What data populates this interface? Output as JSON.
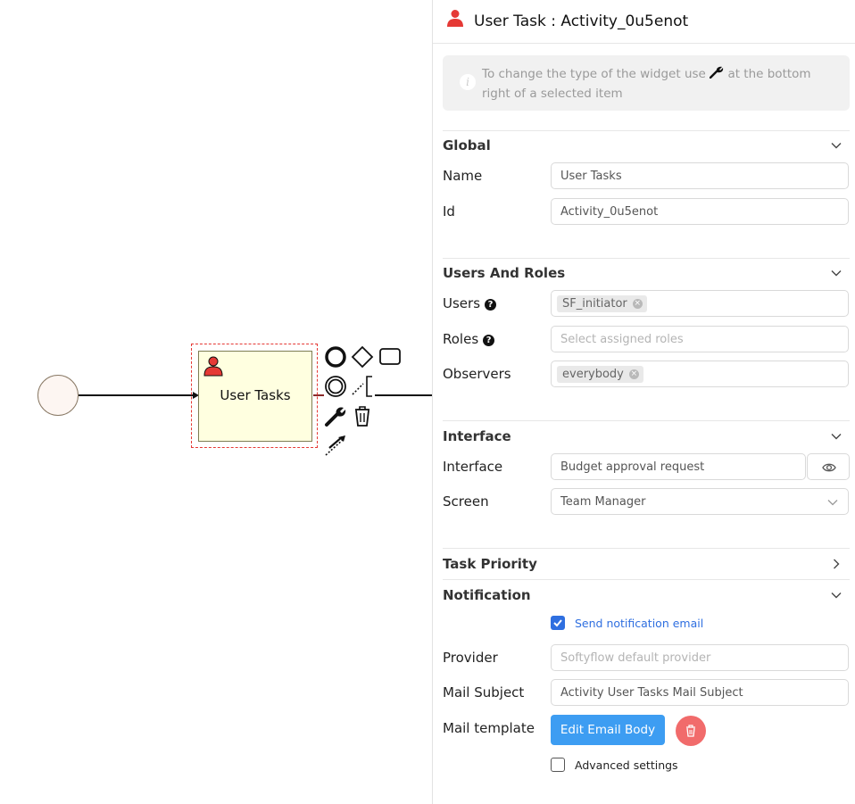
{
  "diagram": {
    "task_label": "User Tasks",
    "task_type_icon": "user-icon",
    "context_pad": [
      "end-event-icon",
      "gateway-icon",
      "task-icon",
      "intermediate-event-icon",
      "text-annotation-icon",
      "wrench-icon",
      "trash-icon",
      "connect-icon"
    ],
    "colors": {
      "selection": "#e53935",
      "task_fill": "#ffffe0",
      "task_border": "#7d7d55",
      "user_icon": "#e53935"
    }
  },
  "panel": {
    "header": {
      "title": "User Task : Activity_0u5enot",
      "icon": "user-icon"
    },
    "info": {
      "icon": "info-icon",
      "text_before": "To change the type of the widget use",
      "text_after": "at the bottom right of a selected item"
    },
    "global": {
      "title": "Global",
      "expanded": true,
      "name_label": "Name",
      "name_value": "User Tasks",
      "id_label": "Id",
      "id_value": "Activity_0u5enot"
    },
    "users_roles": {
      "title": "Users And Roles",
      "expanded": true,
      "users_label": "Users",
      "users_tags": [
        "SF_initiator"
      ],
      "roles_label": "Roles",
      "roles_placeholder": "Select assigned roles",
      "observers_label": "Observers",
      "observers_tags": [
        "everybody"
      ]
    },
    "interface": {
      "title": "Interface",
      "expanded": true,
      "interface_label": "Interface",
      "interface_value": "Budget approval request",
      "screen_label": "Screen",
      "screen_value": "Team Manager"
    },
    "task_priority": {
      "title": "Task Priority",
      "expanded": false
    },
    "notification": {
      "title": "Notification",
      "expanded": true,
      "send_email_label": "Send notification email",
      "send_email_checked": true,
      "provider_label": "Provider",
      "provider_placeholder": "Softyflow default provider",
      "mail_subject_label": "Mail Subject",
      "mail_subject_value": "Activity User Tasks Mail Subject",
      "mail_template_label": "Mail template",
      "edit_body_button": "Edit Email Body",
      "advanced_label": "Advanced settings",
      "advanced_checked": false
    },
    "colors": {
      "primary": "#3d9df2",
      "danger": "#f16b6b",
      "checkbox": "#2f6fe0",
      "link": "#2f6fe0"
    }
  }
}
